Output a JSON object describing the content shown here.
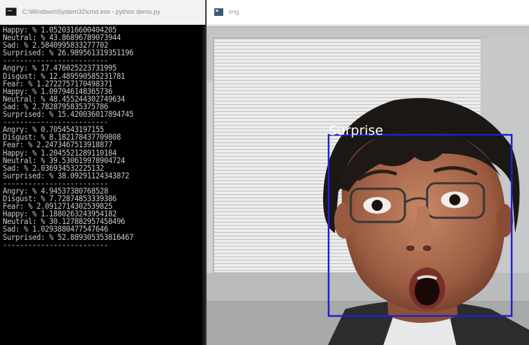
{
  "console": {
    "title": "C:\\Windows\\System32\\cmd.exe - python demo.py",
    "lines": [
      "Happy: % 1.0520316600404205",
      "Neutral: % 43.86896789073944",
      "Sad: % 2.5840995833277702",
      "Surprised: % 26.989561319351196",
      "-------------------------",
      "Angry: % 17.476025223731995",
      "Disgust: % 12.489590585231781",
      "Fear: % 1.2722757170498371",
      "Happy: % 1.097946148365736",
      "Neutral: % 48.455244302749634",
      "Sad: % 2.7828795835375786",
      "Surprised: % 15.420036017894745",
      "-------------------------",
      "Angry: % 0.7054543197155",
      "Disgust: % 8.182178437709808",
      "Fear: % 2.2473467513918877",
      "Happy: % 1.2045521289110184",
      "Neutral: % 39.530619978904724",
      "Sad: % 2.036934532225132",
      "Surprised: % 38.09291124343872",
      "-------------------------",
      "Angry: % 4.94537380768528",
      "Disgust: % 7.72874853339386",
      "Fear: % 2.0912714302539825",
      "Happy: % 1.1880263243954182",
      "Neutral: % 30.127882957458496",
      "Sad: % 1.0293880477547646",
      "Surprised: % 52.889305353816467",
      "-------------------------"
    ]
  },
  "image_window": {
    "title": "img",
    "detection_label": "Surprise",
    "box_color": "#1f1fd0",
    "label_color": "#ffffff"
  },
  "icons": {
    "console_icon": "console-window-icon",
    "image_icon": "image-window-icon"
  }
}
